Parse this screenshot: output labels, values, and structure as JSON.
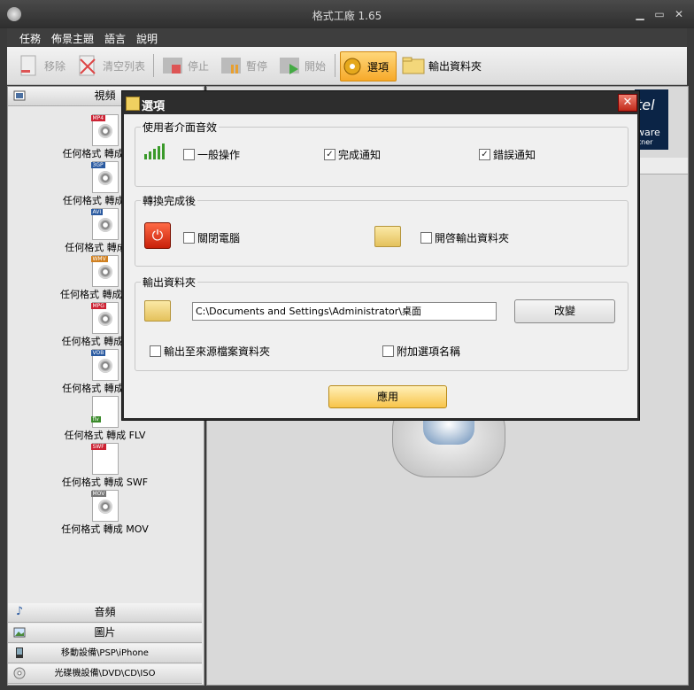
{
  "window": {
    "title": "格式工廠 1.65"
  },
  "menu": [
    "任務",
    "佈景主題",
    "語言",
    "說明"
  ],
  "toolbar": {
    "remove": "移除",
    "clear": "清空列表",
    "stop": "停止",
    "pause": "暫停",
    "start": "開始",
    "options": "選項",
    "output_folder": "輸出資料夾"
  },
  "sidebar": {
    "video_header": "視頻",
    "items": [
      {
        "label": "任何格式 轉成 MP4",
        "tag": "MP4"
      },
      {
        "label": "任何格式 轉成 3GP",
        "tag": "3GP"
      },
      {
        "label": "任何格式 轉成 AVI",
        "tag": "AVI"
      },
      {
        "label": "任何格式 轉成 WMV",
        "tag": "WMV"
      },
      {
        "label": "任何格式 轉成 MPG",
        "tag": "MPG"
      },
      {
        "label": "任何格式 轉成 VOB",
        "tag": "VOB"
      },
      {
        "label": "任何格式 轉成 FLV",
        "tag": "flv"
      },
      {
        "label": "任何格式 轉成 SWF",
        "tag": "SWF"
      },
      {
        "label": "任何格式 轉成 MOV",
        "tag": "MOV"
      }
    ],
    "bottom": [
      "音頻",
      "圖片",
      "移動設備\\PSP\\iPhone",
      "光碟機設備\\DVD\\CD\\ISO"
    ]
  },
  "banner": {
    "line1": "tel",
    "line2": "ware",
    "line3": "tner"
  },
  "dialog": {
    "title": "選項",
    "sound_group": "使用者介面音效",
    "sound_general": "一般操作",
    "sound_done": "完成通知",
    "sound_error": "錯誤通知",
    "after_group": "轉換完成後",
    "shutdown": "關閉電腦",
    "open_output": "開啓輸出資料夾",
    "output_group": "輸出資料夾",
    "output_path": "C:\\Documents and Settings\\Administrator\\桌面",
    "change_button": "改變",
    "to_source": "輸出至來源檔案資料夾",
    "append_name": "附加選項名稱",
    "apply_button": "應用",
    "checked": {
      "sound_general": false,
      "sound_done": true,
      "sound_error": true,
      "shutdown": false,
      "open_output": false,
      "to_source": false,
      "append_name": false
    }
  }
}
